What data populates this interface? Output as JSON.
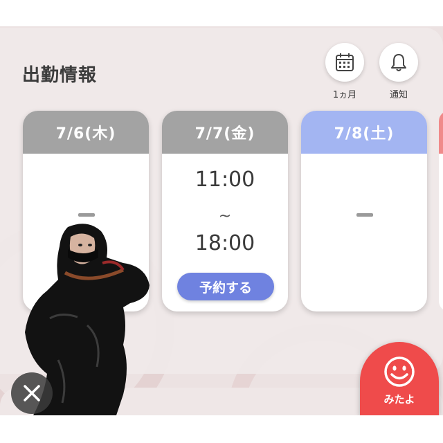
{
  "section": {
    "title": "出勤情報"
  },
  "toolbar": {
    "month_label": "1ヵ月",
    "notify_label": "通知",
    "month_icon": "calendar-icon",
    "notify_icon": "bell-icon"
  },
  "schedule": [
    {
      "date": "7/6(木)",
      "header_color": "#a3a3a3",
      "status": "−",
      "start": "",
      "end": "",
      "tilde": "",
      "reserve_label": ""
    },
    {
      "date": "7/7(金)",
      "header_color": "#a3a3a3",
      "status": "",
      "start": "11:00",
      "end": "18:00",
      "tilde": "~",
      "reserve_label": "予約する"
    },
    {
      "date": "7/8(土)",
      "header_color": "#a3b5f2",
      "status": "−",
      "start": "",
      "end": "",
      "tilde": "",
      "reserve_label": ""
    }
  ],
  "next_card_color": "#f08a8a",
  "mitayo": {
    "label": "みたよ",
    "icon": "smiley-icon",
    "color": "#ef4b4b"
  },
  "close": {
    "icon": "close-icon"
  },
  "colors": {
    "accent": "#6f82e0",
    "panel": "#f0e9e9"
  }
}
